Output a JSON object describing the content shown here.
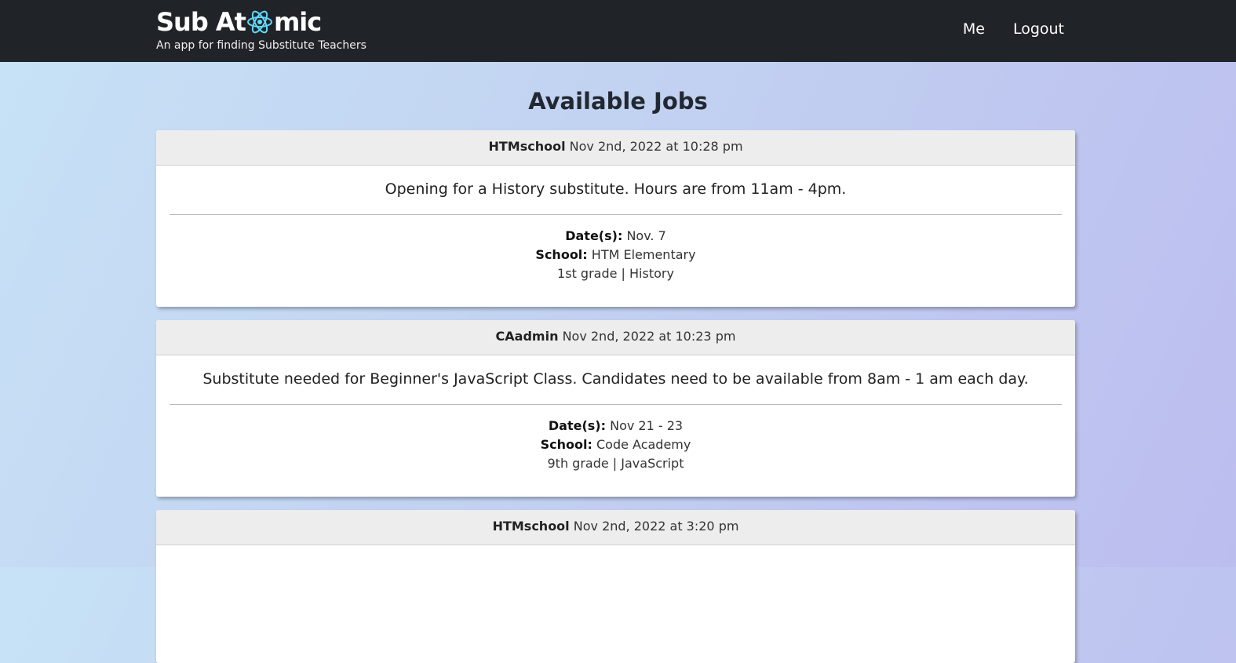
{
  "brand": {
    "title_part1": "Sub At",
    "title_part2": "mic",
    "subtitle": "An app for finding Substitute Teachers",
    "logo_color": "#61dafb"
  },
  "nav": {
    "me": "Me",
    "logout": "Logout"
  },
  "page_title": "Available Jobs",
  "labels": {
    "dates": "Date(s):",
    "school": "School:"
  },
  "jobs": [
    {
      "author": "HTMschool",
      "posted": "Nov 2nd, 2022 at 10:28 pm",
      "description": "Opening for a History substitute. Hours are from 11am - 4pm.",
      "dates": "Nov. 7",
      "school": "HTM Elementary",
      "grade_subject": "1st grade | History"
    },
    {
      "author": "CAadmin",
      "posted": "Nov 2nd, 2022 at 10:23 pm",
      "description": "Substitute needed for Beginner's JavaScript Class. Candidates need to be available from 8am - 1 am each day.",
      "dates": "Nov 21 - 23",
      "school": "Code Academy",
      "grade_subject": "9th grade | JavaScript"
    },
    {
      "author": "HTMschool",
      "posted": "Nov 2nd, 2022 at 3:20 pm"
    }
  ]
}
